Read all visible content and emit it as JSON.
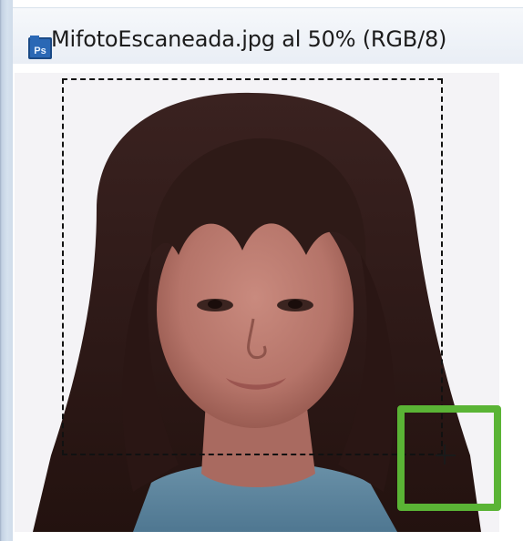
{
  "window": {
    "app_icon_text": "Ps",
    "title": "MifotoEscaneada.jpg al 50% (RGB/8)",
    "app_icon_color": "#1a4a86",
    "highlight_color": "#5ab435"
  },
  "canvas": {
    "background": "#f4f3f6",
    "icon": "photo-image"
  },
  "marquee": {
    "style": "dashed",
    "icon": "selection-marquee"
  },
  "cursor": {
    "icon": "crosshair-icon"
  }
}
